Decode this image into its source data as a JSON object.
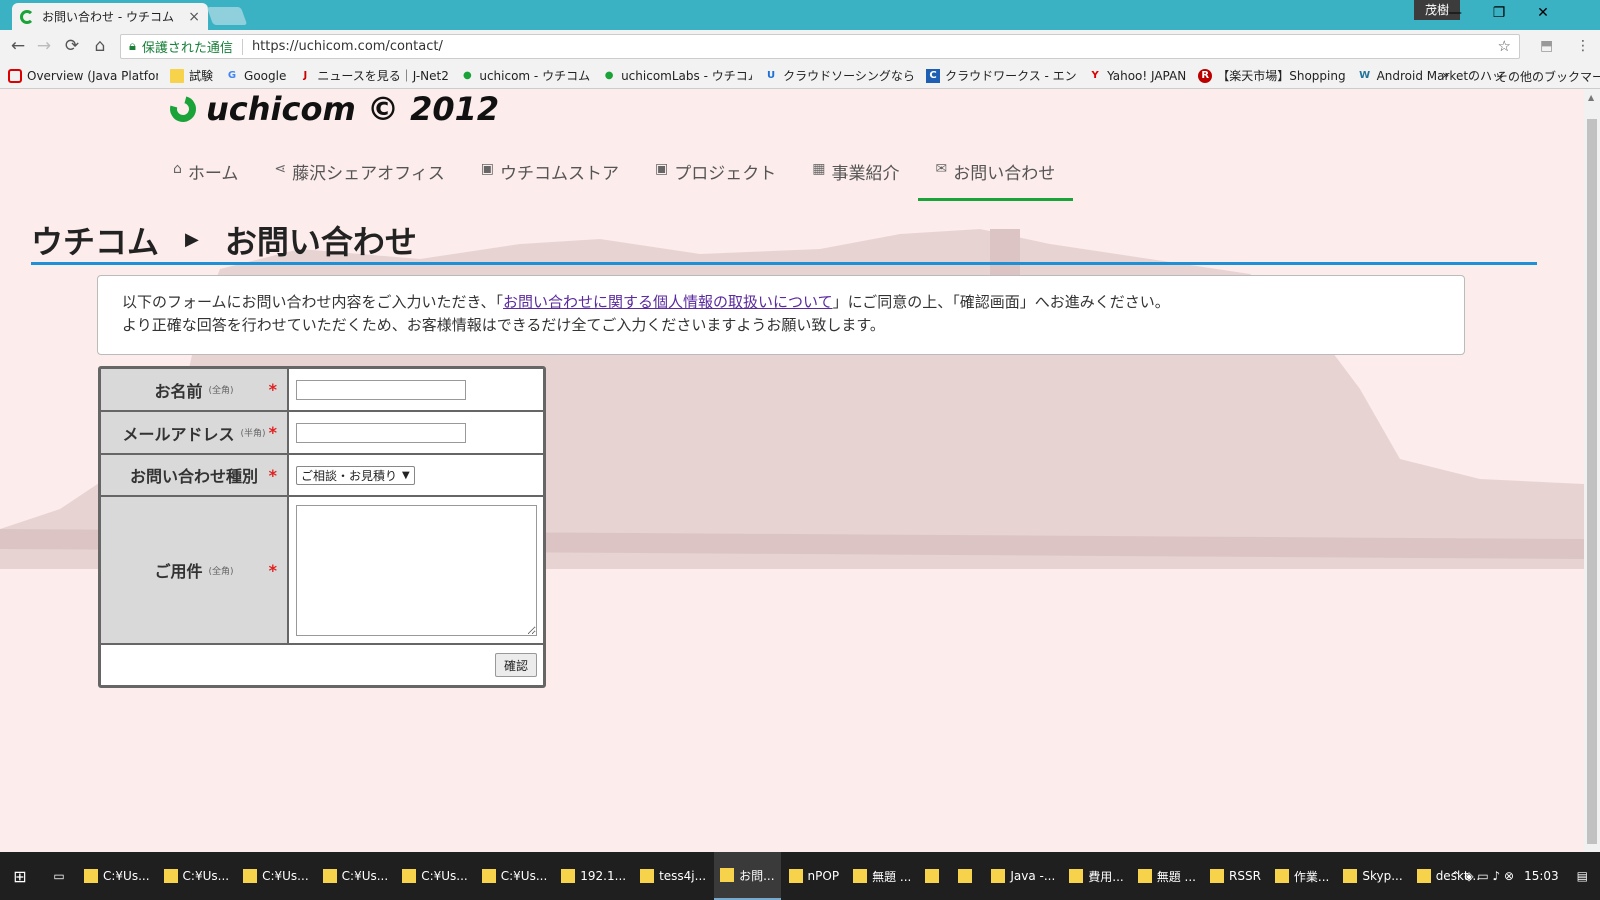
{
  "browser": {
    "tab_title": "お問い合わせ - ウチコム",
    "tab_close": "×",
    "user_badge": "茂樹",
    "window_buttons": [
      "—",
      "❐",
      "✕"
    ],
    "nav_icons": [
      "←",
      "→",
      "⟳",
      "⌂"
    ],
    "secure_label": "保護された通信",
    "url": "https://uchicom.com/contact/",
    "star": "☆",
    "extensions": [
      "⬒",
      "⋮"
    ]
  },
  "bookmarks": [
    {
      "icon": "opera-icon",
      "label": "Overview (Java Platfor"
    },
    {
      "icon": "folder-icon",
      "label": "試験"
    },
    {
      "icon": "google-icon",
      "label": "Google"
    },
    {
      "icon": "j-net-icon",
      "label": "ニュースを見る｜J-Net2"
    },
    {
      "icon": "uchicom-icon",
      "label": "uchicom - ウチコム"
    },
    {
      "icon": "uchicom-icon",
      "label": "uchicomLabs - ウチコム"
    },
    {
      "icon": "lancers-icon",
      "label": "クラウドソーシングなら日"
    },
    {
      "icon": "crowdworks-icon",
      "label": "クラウドワークス - エンジ"
    },
    {
      "icon": "yahoo-icon",
      "label": "Yahoo! JAPAN"
    },
    {
      "icon": "rakuten-icon",
      "label": "【楽天市場】Shopping"
    },
    {
      "icon": "wordpress-icon",
      "label": "Android Marketのハッ"
    }
  ],
  "bookmarks_more": "»",
  "bookmarks_other": "その他のブックマーク",
  "site": {
    "logo_text": "uchicom © 2012",
    "nav": [
      {
        "icon": "home-icon",
        "glyph": "⌂",
        "label": "ホーム"
      },
      {
        "icon": "share-icon",
        "glyph": "⋖",
        "label": "藤沢シェアオフィス"
      },
      {
        "icon": "store-icon",
        "glyph": "▣",
        "label": "ウチコムストア"
      },
      {
        "icon": "project-icon",
        "glyph": "▣",
        "label": "プロジェクト"
      },
      {
        "icon": "building-icon",
        "glyph": "▦",
        "label": "事業紹介"
      },
      {
        "icon": "mail-icon",
        "glyph": "✉",
        "label": "お問い合わせ"
      }
    ],
    "active_nav": 5,
    "breadcrumb": [
      "ウチコム",
      "お問い合わせ"
    ],
    "breadcrumb_arrow": "▶",
    "notice": {
      "line1_before": "以下のフォームにお問い合わせ内容をご入力いただき、「",
      "line1_link": "お問い合わせに関する個人情報の取扱いについて",
      "line1_after": "」にご同意の上、「確認画面」へお進みください。",
      "line2": "より正確な回答を行わせていただくため、お客様情報はできるだけ全てご入力くださいますようお願い致します。"
    },
    "form": {
      "name_label": "お名前",
      "name_note": "(全角)",
      "email_label": "メールアドレス",
      "email_note": "(半角)",
      "type_label": "お問い合わせ種別",
      "type_selected": "ご相談・お見積り",
      "message_label": "ご用件",
      "message_note": "(全角)",
      "required_mark": "*",
      "submit_label": "確認"
    }
  },
  "taskbar": {
    "items": [
      "C:¥Us...",
      "C:¥Us...",
      "C:¥Us...",
      "C:¥Us...",
      "C:¥Us...",
      "C:¥Us...",
      "192.1...",
      "tess4j...",
      "お問...",
      "nPOP",
      "無題 ...",
      "",
      "",
      "Java -...",
      "費用...",
      "無題 ...",
      "RSSR",
      "作業...",
      "Skyp...",
      "deskt..."
    ],
    "active_index": 8,
    "time": "15:03"
  },
  "colors": {
    "accent_green": "#1aa338",
    "heading_rule": "#1e90d6",
    "page_bg": "#fdecec",
    "titlebar": "#3bb2c4"
  }
}
